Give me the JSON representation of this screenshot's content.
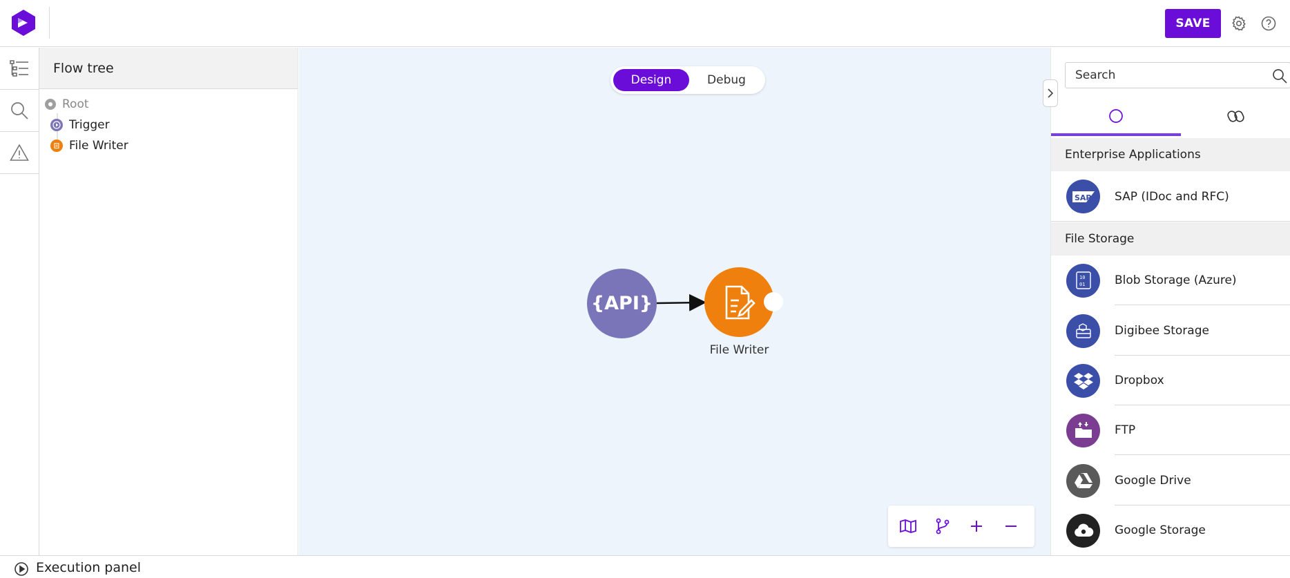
{
  "topbar": {
    "logo_icon": "digibee-logo-icon",
    "save_label": "SAVE",
    "settings_icon": "gear-icon",
    "help_icon": "help-icon",
    "accent_color": "#6a0dd9"
  },
  "left_rail": {
    "items": [
      {
        "icon": "flow-tree-icon"
      },
      {
        "icon": "search-icon"
      },
      {
        "icon": "warning-icon"
      }
    ]
  },
  "flow_tree": {
    "title": "Flow tree",
    "nodes": [
      {
        "label": "Root",
        "color": "#9e9e9e"
      },
      {
        "label": "Trigger",
        "color": "#7a74b8"
      },
      {
        "label": "File Writer",
        "color": "#f0800e"
      }
    ]
  },
  "canvas": {
    "mode_toggle": {
      "options": [
        "Design",
        "Debug"
      ],
      "selected": "Design"
    },
    "trigger_node": {
      "label": "{API}",
      "color": "#7a74b8"
    },
    "file_writer_node": {
      "label": "File Writer",
      "color": "#f0800e"
    },
    "controls": [
      {
        "icon": "map-icon"
      },
      {
        "icon": "branch-icon"
      },
      {
        "icon": "zoom-in-icon"
      },
      {
        "icon": "zoom-out-icon"
      }
    ]
  },
  "right_panel": {
    "collapse_icon": "chevron-right-icon",
    "search": {
      "placeholder": "Search",
      "value": ""
    },
    "tabs": [
      {
        "icon": "circle-icon",
        "active": true
      },
      {
        "icon": "capsules-icon",
        "active": false
      }
    ],
    "sections": [
      {
        "title": "Enterprise Applications",
        "items": [
          {
            "label": "SAP (IDoc and RFC)",
            "icon": "sap-icon",
            "color": "#3b4ea8"
          }
        ]
      },
      {
        "title": "File Storage",
        "items": [
          {
            "label": "Blob Storage (Azure)",
            "icon": "blob-storage-icon",
            "color": "#3b4ea8"
          },
          {
            "label": "Digibee Storage",
            "icon": "digibee-storage-icon",
            "color": "#3b4ea8"
          },
          {
            "label": "Dropbox",
            "icon": "dropbox-icon",
            "color": "#3b4ea8"
          },
          {
            "label": "FTP",
            "icon": "ftp-folder-icon",
            "color": "#7a3d91"
          },
          {
            "label": "Google Drive",
            "icon": "google-drive-icon",
            "color": "#5a5a5a"
          },
          {
            "label": "Google Storage",
            "icon": "google-storage-icon",
            "color": "#222222"
          }
        ]
      }
    ]
  },
  "execution_panel": {
    "label": "Execution panel",
    "icon": "play-circle-icon"
  }
}
